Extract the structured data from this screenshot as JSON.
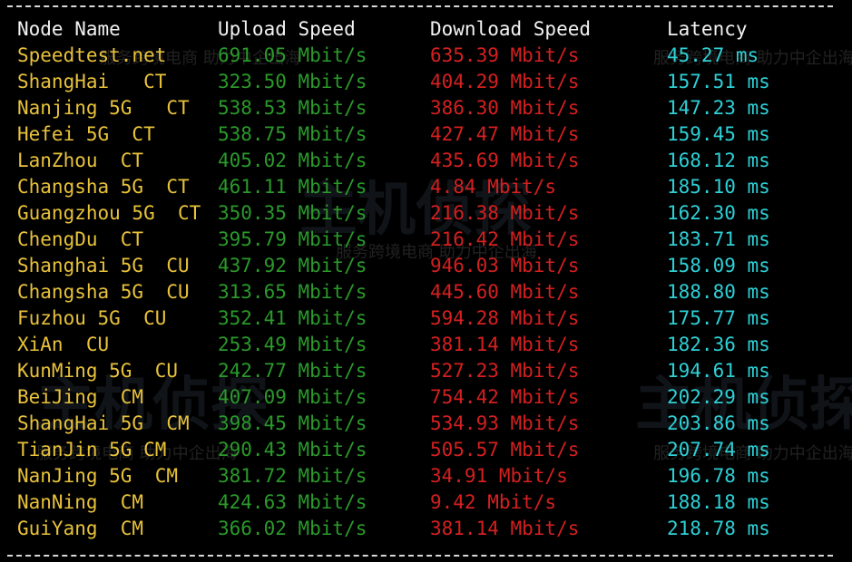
{
  "header": {
    "node": "Node Name",
    "upload": "Upload Speed",
    "download": "Download Speed",
    "latency": "Latency"
  },
  "rows": [
    {
      "node": "Speedtest.net",
      "upload": "691.05 Mbit/s",
      "download": "635.39 Mbit/s",
      "latency": "45.27 ms"
    },
    {
      "node": "ShangHai   CT",
      "upload": "323.50 Mbit/s",
      "download": "404.29 Mbit/s",
      "latency": "157.51 ms"
    },
    {
      "node": "Nanjing 5G   CT",
      "upload": "538.53 Mbit/s",
      "download": "386.30 Mbit/s",
      "latency": "147.23 ms"
    },
    {
      "node": "Hefei 5G  CT",
      "upload": "538.75 Mbit/s",
      "download": "427.47 Mbit/s",
      "latency": "159.45 ms"
    },
    {
      "node": "LanZhou  CT",
      "upload": "405.02 Mbit/s",
      "download": "435.69 Mbit/s",
      "latency": "168.12 ms"
    },
    {
      "node": "Changsha 5G  CT",
      "upload": "461.11 Mbit/s",
      "download": "4.84 Mbit/s",
      "latency": "185.10 ms"
    },
    {
      "node": "Guangzhou 5G  CT",
      "upload": "350.35 Mbit/s",
      "download": "216.38 Mbit/s",
      "latency": "162.30 ms"
    },
    {
      "node": "ChengDu  CT",
      "upload": "395.79 Mbit/s",
      "download": "216.42 Mbit/s",
      "latency": "183.71 ms"
    },
    {
      "node": "Shanghai 5G  CU",
      "upload": "437.92 Mbit/s",
      "download": "946.03 Mbit/s",
      "latency": "158.09 ms"
    },
    {
      "node": "Changsha 5G  CU",
      "upload": "313.65 Mbit/s",
      "download": "445.60 Mbit/s",
      "latency": "188.80 ms"
    },
    {
      "node": "Fuzhou 5G  CU",
      "upload": "352.41 Mbit/s",
      "download": "594.28 Mbit/s",
      "latency": "175.77 ms"
    },
    {
      "node": "XiAn  CU",
      "upload": "253.49 Mbit/s",
      "download": "381.14 Mbit/s",
      "latency": "182.36 ms"
    },
    {
      "node": "KunMing 5G  CU",
      "upload": "242.77 Mbit/s",
      "download": "527.23 Mbit/s",
      "latency": "194.61 ms"
    },
    {
      "node": "BeiJing  CM",
      "upload": "407.09 Mbit/s",
      "download": "754.42 Mbit/s",
      "latency": "202.29 ms"
    },
    {
      "node": "ShangHai 5G  CM",
      "upload": "398.45 Mbit/s",
      "download": "534.93 Mbit/s",
      "latency": "203.86 ms"
    },
    {
      "node": "TianJin 5G CM",
      "upload": "290.43 Mbit/s",
      "download": "505.57 Mbit/s",
      "latency": "207.74 ms"
    },
    {
      "node": "NanJing 5G  CM",
      "upload": "381.72 Mbit/s",
      "download": "34.91 Mbit/s",
      "latency": "196.78 ms"
    },
    {
      "node": "NanNing  CM",
      "upload": "424.63 Mbit/s",
      "download": "9.42 Mbit/s",
      "latency": "188.18 ms"
    },
    {
      "node": "GuiYang  CM",
      "upload": "366.02 Mbit/s",
      "download": "381.14 Mbit/s",
      "latency": "218.78 ms"
    }
  ],
  "watermark": {
    "slogan": "服务跨境电商 助力中企出海",
    "brand": "主机侦探"
  },
  "colors": {
    "background": "#000000",
    "node": "#e8c23a",
    "upload": "#2a9a2a",
    "download": "#d42020",
    "latency": "#2ed0d6",
    "header": "#f2f2f2"
  }
}
